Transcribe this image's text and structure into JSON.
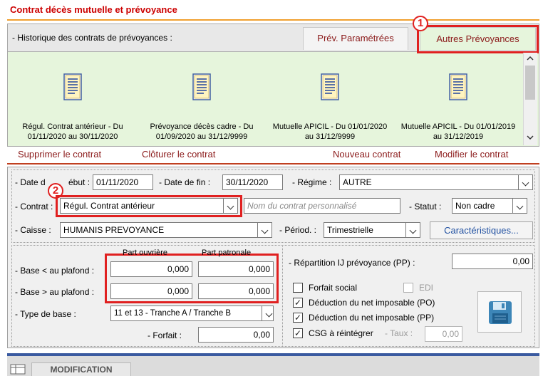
{
  "title": "Contrat décès mutuelle et prévoyance",
  "history": {
    "label": "- Historique des contrats de prévoyances :",
    "tab_parametrees": "Prév. Paramétrées",
    "tab_autres": "Autres Prévoyances",
    "contracts": [
      {
        "line1": "Régul. Contrat antérieur - Du",
        "line2": "01/11/2020 au 30/11/2020"
      },
      {
        "line1": "Prévoyance décès cadre - Du",
        "line2": "01/09/2020 au 31/12/9999"
      },
      {
        "line1": "Mutuelle APICIL - Du 01/01/2020",
        "line2": "au 31/12/9999"
      },
      {
        "line1": "Mutuelle APICIL - Du 01/01/2019",
        "line2": "au 31/12/2019"
      }
    ]
  },
  "markers": {
    "one": "1",
    "two": "2"
  },
  "actions": {
    "supprimer": "Supprimer le contrat",
    "cloturer": "Clôturer le contrat",
    "nouveau": "Nouveau contrat",
    "modifier": "Modifier le contrat"
  },
  "form": {
    "date_debut_label_a": "- Date d",
    "date_debut_label_b": "ébut :",
    "date_debut": "01/11/2020",
    "date_fin_label": "- Date de fin :",
    "date_fin": "30/11/2020",
    "regime_label": "- Régime :",
    "regime": "AUTRE",
    "contrat_label": "- Contrat :",
    "contrat": "Régul. Contrat antérieur",
    "contrat_perso_placeholder": "Nom du contrat personnalisé",
    "statut_label": "- Statut :",
    "statut": "Non cadre",
    "caisse_label": "- Caisse :",
    "caisse": "HUMANIS PREVOYANCE",
    "periode_label": "- Périod. :",
    "periode": "Trimestrielle",
    "caracteristiques": "Caractéristiques...",
    "part_ouvriere": "Part ouvrière",
    "part_patronale": "Part patronale",
    "base_inf_label": "- Base < au plafond :",
    "base_sup_label": "- Base > au plafond :",
    "base_inf_ouvriere": "0,000",
    "base_inf_patronale": "0,000",
    "base_sup_ouvriere": "0,000",
    "base_sup_patronale": "0,000",
    "type_base_label": "- Type de base :",
    "type_base": "11 et 13 - Tranche A / Tranche B",
    "forfait_label": "- Forfait :",
    "forfait": "0,00",
    "repartition_label": "- Répartition IJ prévoyance (PP) :",
    "repartition": "0,00",
    "forfait_social": "Forfait social",
    "edi": "EDI",
    "deduction_po": "Déduction du net imposable (PO)",
    "deduction_pp": "Déduction du net imposable (PP)",
    "csg": "CSG à réintégrer",
    "taux_label": "- Taux :",
    "taux": "0,00",
    "check_mark": "✓"
  },
  "status": {
    "mode": "MODIFICATION"
  },
  "colors": {
    "accent_red": "#e02020",
    "title_red": "#cc0000",
    "link": "#8b1a1a",
    "history_bg": "#e6f5dc"
  },
  "icons": [
    "document-icon",
    "floppy-save-icon",
    "chevron-down-icon",
    "scroll-up-icon",
    "scroll-down-icon",
    "status-grid-icon"
  ]
}
